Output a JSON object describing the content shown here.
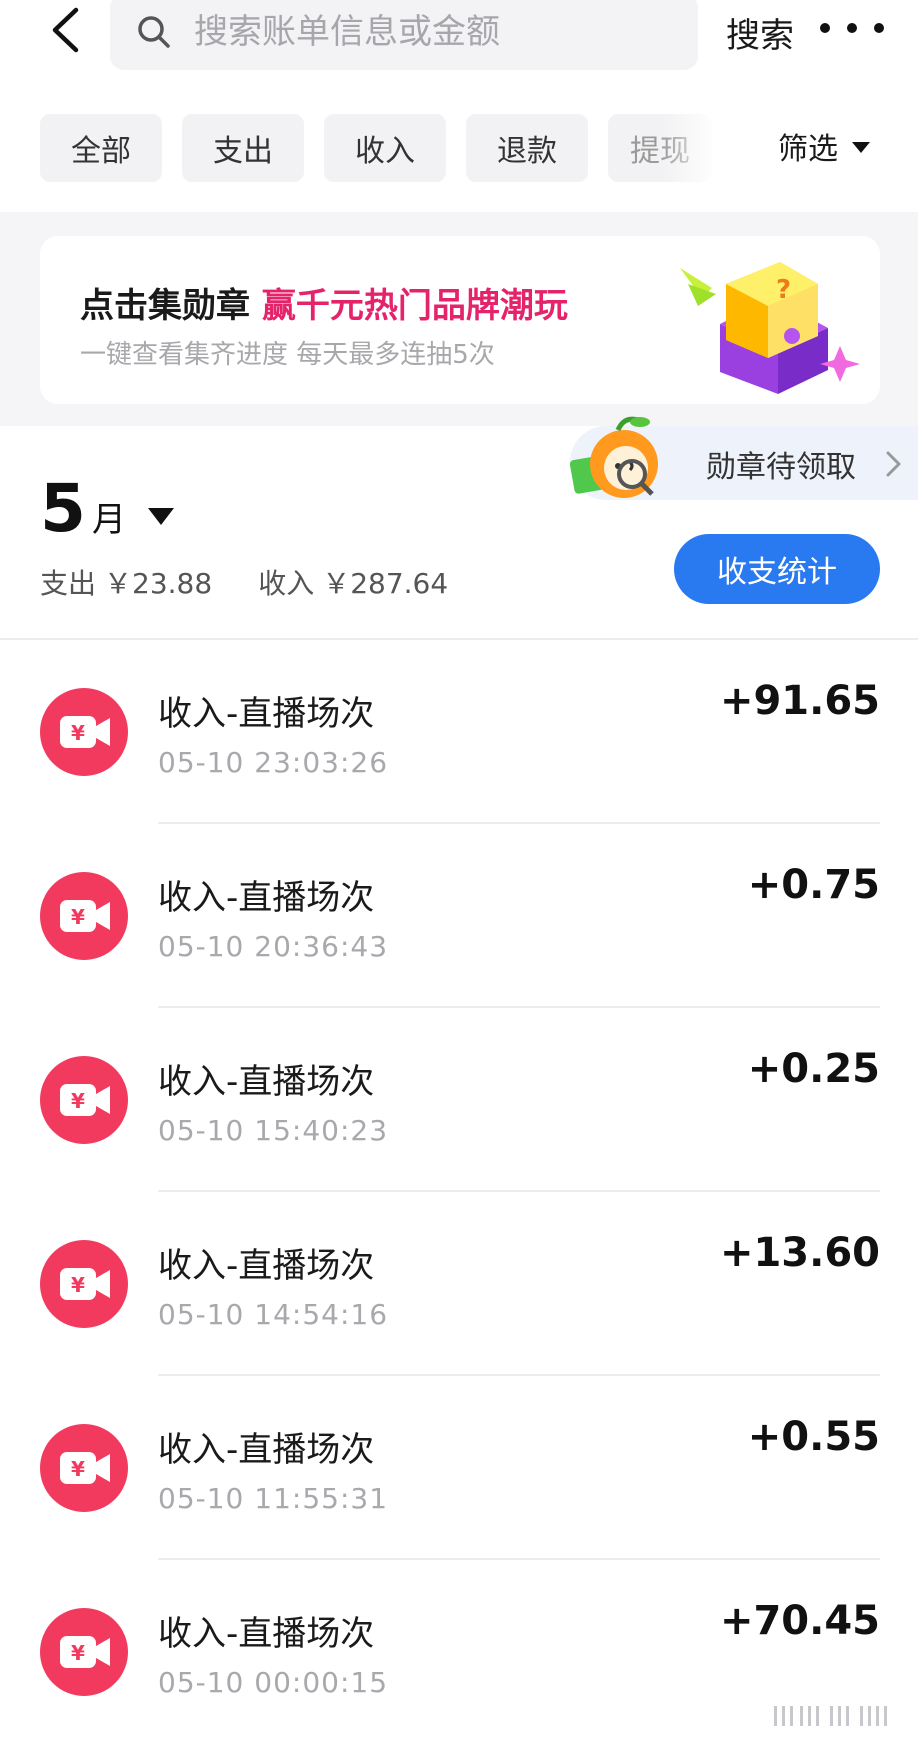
{
  "header": {
    "search_placeholder": "搜索账单信息或金额",
    "search_button": "搜索",
    "back_icon": "chevron-left-icon",
    "more_icon": "more-horizontal-icon"
  },
  "tabs": [
    {
      "label": "全部"
    },
    {
      "label": "支出"
    },
    {
      "label": "收入"
    },
    {
      "label": "退款"
    },
    {
      "label": "提现"
    }
  ],
  "filter": {
    "label": "筛选"
  },
  "banner": {
    "title_prefix": "点击集勋章",
    "title_highlight": "赢千元热门品牌潮玩",
    "subtitle": "一键查看集齐进度 每天最多连抽5次",
    "highlight_color": "#e5236a"
  },
  "medal": {
    "label": "勋章待领取"
  },
  "month": {
    "number": "5",
    "unit": "月",
    "expense_label": "支出",
    "expense_value": "￥23.88",
    "income_label": "收入",
    "income_value": "￥287.64",
    "stats_button": "收支统计",
    "accent_color": "#2979f0"
  },
  "transactions": [
    {
      "title": "收入-直播场次",
      "time": "05-10 23:03:26",
      "amount": "+91.65"
    },
    {
      "title": "收入-直播场次",
      "time": "05-10 20:36:43",
      "amount": "+0.75"
    },
    {
      "title": "收入-直播场次",
      "time": "05-10 15:40:23",
      "amount": "+0.25"
    },
    {
      "title": "收入-直播场次",
      "time": "05-10 14:54:16",
      "amount": "+13.60"
    },
    {
      "title": "收入-直播场次",
      "time": "05-10 11:55:31",
      "amount": "+0.55"
    },
    {
      "title": "收入-直播场次",
      "time": "05-10 00:00:15",
      "amount": "+70.45"
    }
  ],
  "transaction_icon": "live-video-yuan-icon",
  "transaction_icon_color": "#f23a5f"
}
